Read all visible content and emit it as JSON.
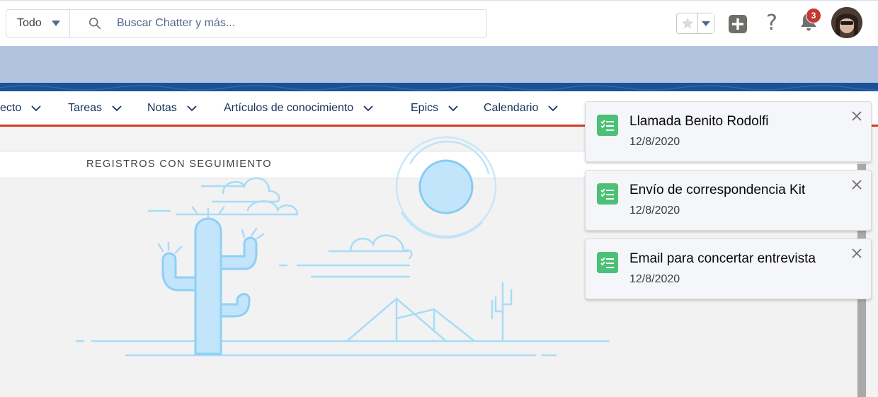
{
  "search": {
    "scope_label": "Todo",
    "placeholder": "Buscar Chatter y más..."
  },
  "header": {
    "notification_count": "3",
    "icons": [
      "star-icon",
      "chevron-down-icon",
      "add-icon",
      "help-icon",
      "bell-icon",
      "avatar"
    ]
  },
  "nav": {
    "items": [
      {
        "label": "ecto"
      },
      {
        "label": "Tareas"
      },
      {
        "label": "Notas"
      },
      {
        "label": "Artículos de conocimiento"
      },
      {
        "label": "Epics"
      },
      {
        "label": "Calendario"
      }
    ]
  },
  "panel": {
    "title": "REGISTROS CON SEGUIMIENTO"
  },
  "toasts": [
    {
      "title": "Llamada Benito Rodolfi",
      "date": "12/8/2020"
    },
    {
      "title": "Envío de correspondencia Kit",
      "date": "12/8/2020"
    },
    {
      "title": "Email para concertar entrevista",
      "date": "12/8/2020"
    }
  ],
  "colors": {
    "accent_bar": "#d5391d",
    "brand_strip": "#1b5297",
    "banner": "#b0c4df",
    "task_green": "#4bc076",
    "badge_red": "#c23934",
    "illustration_blue": "#a8dcf7"
  }
}
